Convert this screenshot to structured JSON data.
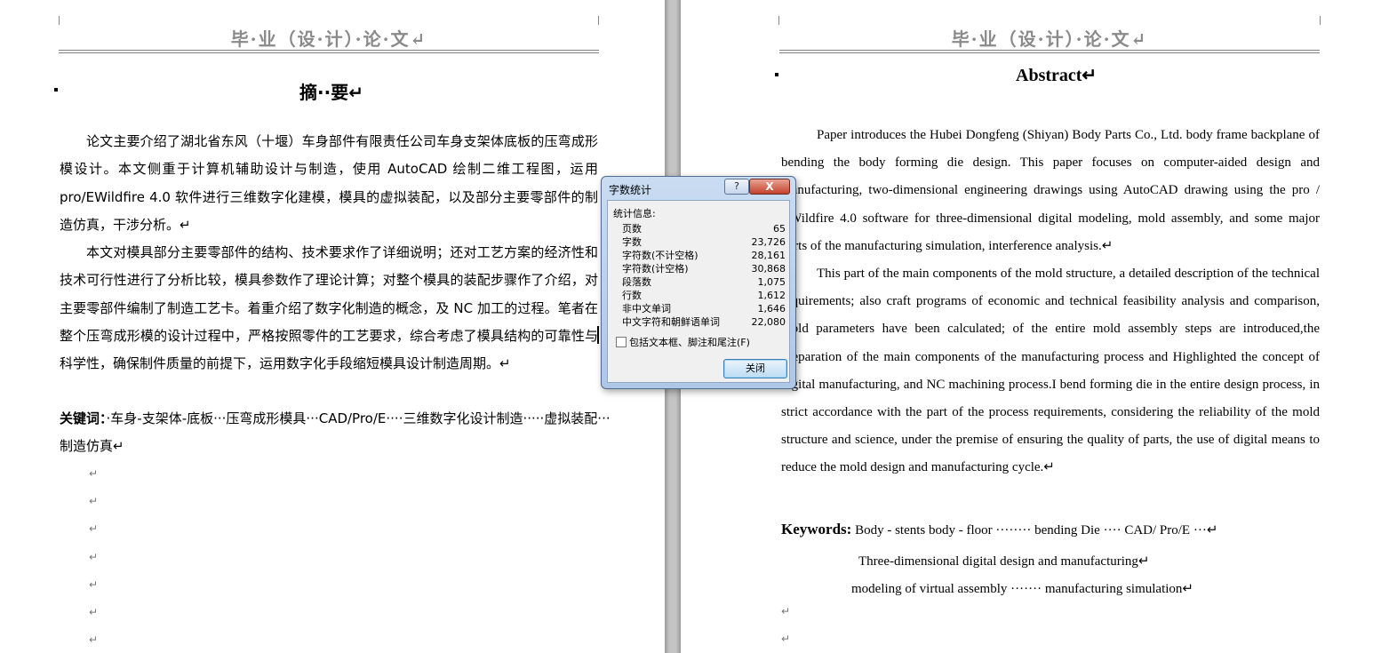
{
  "header": {
    "left_title": "毕·业（设·计）·论·文↵",
    "right_title": "毕·业（设·计）·论·文↵"
  },
  "cn": {
    "title": "摘··要↵",
    "paragraphs": [
      "论文主要介绍了湖北省东风（十堰）车身部件有限责任公司车身支架体底板的压弯成形模设计。本文侧重于计算机辅助设计与制造，使用 AutoCAD 绘制二维工程图，运用 pro/EWildfire 4.0 软件进行三维数字化建模，模具的虚拟装配，以及部分主要零部件的制造仿真，干涉分析。↵",
      "本文对模具部分主要零部件的结构、技术要求作了详细说明；还对工艺方案的经济性和技术可行性进行了分析比较，模具参数作了理论计算；对整个模具的装配步骤作了介绍，对主要零部件编制了制造工艺卡。着重介绍了数字化制造的概念，及 NC 加工的过程。笔者在整个压弯成形模的设计过程中，严格按照零件的工艺要求，综合考虑了模具结构的可靠性与科学性，确保制件质量的前提下，运用数字化手段缩短模具设计制造周期。↵"
    ],
    "keywords_label": "关键词：",
    "keywords_text": "·车身-支架体-底板···压弯成形模具···CAD/Pro/E····三维数字化设计制造·····虚拟装配···制造仿真↵",
    "empty_marks": [
      "↵",
      "↵",
      "↵",
      "↵",
      "↵",
      "↵",
      "↵"
    ]
  },
  "en": {
    "title": "Abstract↵",
    "paragraphs": [
      "Paper introduces the Hubei Dongfeng (Shiyan) Body Parts Co., Ltd. body frame backplane of bending the body forming die design. This paper focuses on computer-aided design and manufacturing, two-dimensional engineering drawings using AutoCAD drawing using the pro / EWildfire 4.0 software for three-dimensional digital modeling, mold assembly, and some major parts of the manufacturing simulation, interference analysis.↵",
      "This part of the main components of the mold structure, a detailed description of the technical requirements; also craft programs of economic and technical feasibility analysis and comparison, mold parameters have been calculated; of the entire mold assembly steps are introduced,the preparation of the main components of the manufacturing process and Highlighted the concept of digital manufacturing, and NC machining process.I bend forming die in the entire design process, in strict accordance with the part of the process requirements, considering the reliability of the mold structure and science, under the premise of ensuring the quality of parts, the use of digital means to reduce the mold design and manufacturing cycle.↵"
    ],
    "keywords_label": "Keywords:",
    "keywords_line1": " Body - stents body - floor ········ bending Die ···· CAD/ Pro/E ···↵",
    "keywords_line2": "Three-dimensional  digital design and manufacturing↵",
    "keywords_line3": "modeling of virtual assembly ······· manufacturing simulation↵",
    "empty_marks": [
      "↵",
      "↵"
    ]
  },
  "dialog": {
    "title": "字数统计",
    "help": "?",
    "close_x": "X",
    "section": "统计信息:",
    "stats": [
      {
        "label": "页数",
        "value": "65"
      },
      {
        "label": "字数",
        "value": "23,726"
      },
      {
        "label": "字符数(不计空格)",
        "value": "28,161"
      },
      {
        "label": "字符数(计空格)",
        "value": "30,868"
      },
      {
        "label": "段落数",
        "value": "1,075"
      },
      {
        "label": "行数",
        "value": "1,612"
      },
      {
        "label": "非中文单词",
        "value": "1,646"
      },
      {
        "label": "中文字符和朝鲜语单词",
        "value": "22,080"
      }
    ],
    "checkbox_label": "包括文本框、脚注和尾注(F)",
    "close_button": "关闭"
  }
}
